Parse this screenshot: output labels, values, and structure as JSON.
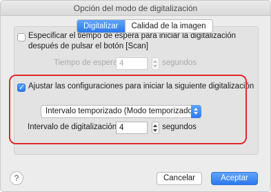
{
  "window": {
    "title": "Opción del modo de digitalización"
  },
  "tabs": [
    {
      "label": "Digitalizar",
      "active": true
    },
    {
      "label": "Calidad de la imagen",
      "active": false
    }
  ],
  "wait_option": {
    "checked": false,
    "label_line1": "Especificar el tiempo de espera para iniciar la digitalización",
    "label_line2": "después de pulsar el botón [Scan]",
    "field_label": "Tiempo de espera:",
    "value": "4",
    "unit": "segundos",
    "enabled": false
  },
  "adjust_option": {
    "checked": true,
    "label": "Ajustar las configuraciones para iniciar la siguiente digitalización",
    "mode_select": {
      "selected": "Intervalo temporizado (Modo temporizado)"
    },
    "interval_label": "Intervalo de digitalización:",
    "interval_value": "4",
    "interval_unit": "segundos"
  },
  "footer": {
    "help_glyph": "?",
    "cancel_label": "Cancelar",
    "accept_label": "Aceptar"
  },
  "colors": {
    "accent": "#2c78f0",
    "highlight": "#e0282e"
  },
  "icons": {
    "help": "question-mark-icon",
    "stepper": "stepper-arrows-icon",
    "popup": "popup-arrows-icon"
  }
}
